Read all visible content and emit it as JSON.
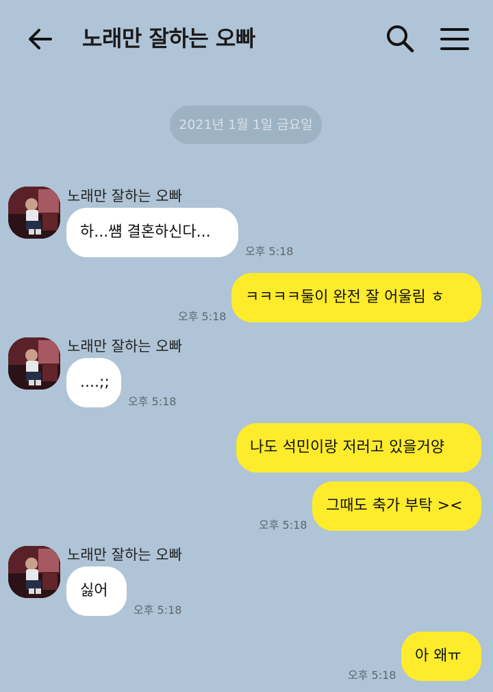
{
  "header": {
    "title": "노래만 잘하는 오빠",
    "back_icon": "arrow-left-icon",
    "search_icon": "search-icon",
    "menu_icon": "hamburger-menu-icon"
  },
  "date_divider": "2021년 1월 1일 금요일",
  "colors": {
    "background": "#afc4d6",
    "incoming_bubble": "#ffffff",
    "outgoing_bubble": "#fdeb2c"
  },
  "messages": [
    {
      "direction": "in",
      "sender": "노래만 잘하는 오빠",
      "text": "하...썜 결혼하신다...",
      "time": "오후 5:18"
    },
    {
      "direction": "out",
      "text": "ㅋㅋㅋㅋ둘이 완전 잘 어울림 ㅎ",
      "time": "오후 5:18"
    },
    {
      "direction": "in",
      "sender": "노래만 잘하는 오빠",
      "text": "....;;",
      "time": "오후 5:18"
    },
    {
      "direction": "out",
      "text": "나도 석민이랑 저러고 있을거양",
      "time": ""
    },
    {
      "direction": "out",
      "text": "그때도 축가 부탁 ><",
      "time": "오후 5:18"
    },
    {
      "direction": "in",
      "sender": "노래만 잘하는 오빠",
      "text": "싫어",
      "time": "오후 5:18"
    },
    {
      "direction": "out",
      "text": "아 왜ㅠ",
      "time": "오후 5:18"
    }
  ]
}
